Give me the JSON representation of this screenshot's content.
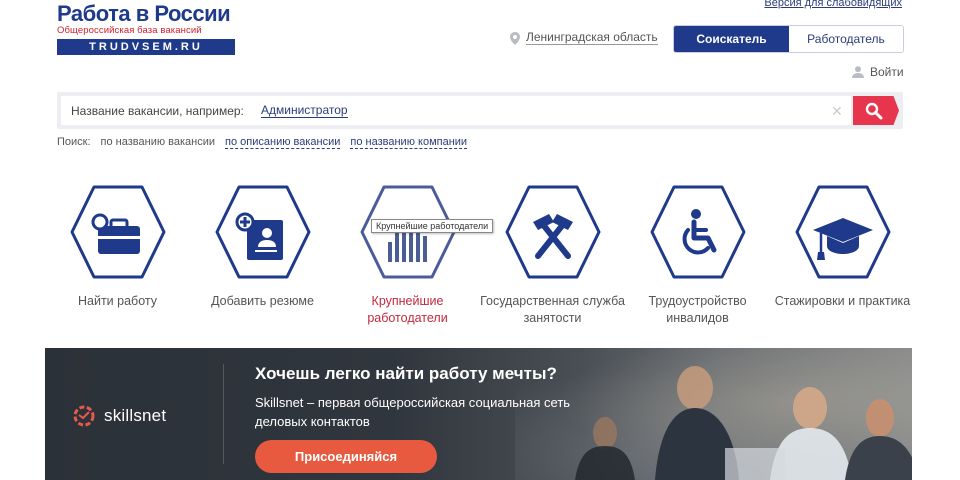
{
  "header": {
    "accessibility_link": "Версия для слабовидящих",
    "logo": {
      "title": "Работа в России",
      "subtitle": "Общероссийская база вакансий",
      "domain": "TRUDVSEM.RU"
    },
    "region": "Ленинградская область",
    "roles": [
      "Соискатель",
      "Работодатель"
    ],
    "active_role": "Соискатель",
    "login": "Войти"
  },
  "search": {
    "placeholder": "Название вакансии, например:",
    "example": "Администратор",
    "modes_label": "Поиск:",
    "modes": [
      "по названию вакансии",
      "по описанию вакансии",
      "по названию компании"
    ],
    "active_mode": "по названию вакансии"
  },
  "categories": [
    {
      "label": "Найти работу",
      "icon": "briefcase-search-icon"
    },
    {
      "label": "Добавить резюме",
      "icon": "add-resume-icon"
    },
    {
      "label": "Крупнейшие работодатели",
      "icon": "bar-chart-icon",
      "highlight": true
    },
    {
      "label": "Государственная служба занятости",
      "icon": "crossed-hammers-icon"
    },
    {
      "label": "Трудоустройство инвалидов",
      "icon": "wheelchair-icon"
    },
    {
      "label": "Стажировки и практика",
      "icon": "graduation-cap-icon"
    }
  ],
  "tooltip": "Крупнейшие работодатели",
  "banner": {
    "brand": "skillsnet",
    "title": "Хочешь легко найти работу мечты?",
    "text": "Skillsnet – первая общероссийская социальная сеть деловых контактов",
    "button": "Присоединяйся"
  },
  "colors": {
    "brand_blue": "#1f3a8a",
    "accent_red": "#e8354e",
    "banner_button": "#e85a40",
    "highlight_text": "#c22a3b"
  }
}
